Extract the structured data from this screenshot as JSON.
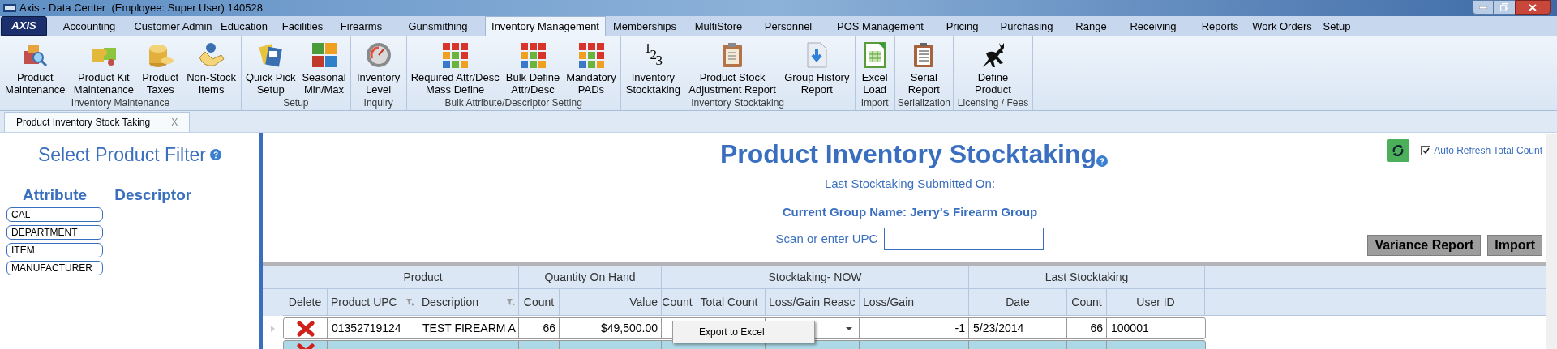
{
  "window": {
    "title": "Axis - Data Center  (Employee: Super User) 140528"
  },
  "logo": "AXIS",
  "menu_tabs": [
    {
      "label": "Accounting",
      "selected": false
    },
    {
      "label": "Customer Admin",
      "selected": false
    },
    {
      "label": "Education",
      "selected": false
    },
    {
      "label": "Facilities",
      "selected": false
    },
    {
      "label": "Firearms",
      "selected": false
    },
    {
      "label": "Gunsmithing",
      "selected": false
    },
    {
      "label": "Inventory Management",
      "selected": true
    },
    {
      "label": "Memberships",
      "selected": false
    },
    {
      "label": "MultiStore",
      "selected": false
    },
    {
      "label": "Personnel",
      "selected": false
    },
    {
      "label": "POS Management",
      "selected": false
    },
    {
      "label": "Pricing",
      "selected": false
    },
    {
      "label": "Purchasing",
      "selected": false
    },
    {
      "label": "Range",
      "selected": false
    },
    {
      "label": "Receiving",
      "selected": false
    },
    {
      "label": "Reports",
      "selected": false
    },
    {
      "label": "Work Orders",
      "selected": false
    },
    {
      "label": "Setup",
      "selected": false
    }
  ],
  "ribbon_groups": [
    {
      "label": "Inventory Maintenance",
      "buttons": [
        {
          "label": "Product\nMaintenance"
        },
        {
          "label": "Product Kit\nMaintenance"
        },
        {
          "label": "Product\nTaxes"
        },
        {
          "label": "Non-Stock\nItems"
        }
      ]
    },
    {
      "label": "Setup",
      "buttons": [
        {
          "label": "Quick Pick\nSetup"
        },
        {
          "label": "Seasonal\nMin/Max"
        }
      ]
    },
    {
      "label": "Inquiry",
      "buttons": [
        {
          "label": "Inventory\nLevel"
        }
      ]
    },
    {
      "label": "Bulk Attribute/Descriptor Setting",
      "buttons": [
        {
          "label": "Required Attr/Desc\nMass Define"
        },
        {
          "label": "Bulk Define\nAttr/Desc"
        },
        {
          "label": "Mandatory\nPADs"
        }
      ]
    },
    {
      "label": "Inventory Stocktaking",
      "buttons": [
        {
          "label": "Inventory\nStocktaking",
          "glyph": "123"
        },
        {
          "label": "Product Stock\nAdjustment Report"
        },
        {
          "label": "Group History\nReport"
        }
      ]
    },
    {
      "label": "Import",
      "buttons": [
        {
          "label": "Excel\nLoad"
        }
      ]
    },
    {
      "label": "Serialization",
      "buttons": [
        {
          "label": "Serial\nReport"
        }
      ]
    },
    {
      "label": "Licensing / Fees",
      "buttons": [
        {
          "label": "Define\nProduct"
        }
      ]
    }
  ],
  "doc_tabs": [
    {
      "label": "Product Inventory Stock Taking",
      "close": "X",
      "selected": true
    }
  ],
  "filter": {
    "title": "Select Product Filter",
    "attribute_heading": "Attribute",
    "descriptor_heading": "Descriptor",
    "attributes": [
      "CAL",
      "DEPARTMENT",
      "ITEM",
      "MANUFACTURER"
    ]
  },
  "main": {
    "title": "Product Inventory Stocktaking",
    "last_submitted": "Last Stocktaking Submitted On:",
    "group_name": "Current Group Name: Jerry's Firearm Group",
    "upc_label": "Scan or enter UPC",
    "auto_refresh": {
      "label": "Auto Refresh Total Count",
      "checked": true
    },
    "buttons": [
      "Variance Report",
      "Import"
    ]
  },
  "table": {
    "column_groups": [
      "Product",
      "Quantity On Hand",
      "Stocktaking- NOW",
      "Last Stocktaking"
    ],
    "columns": [
      "Delete",
      "Product UPC",
      "Description",
      "Count",
      "Value",
      "Count",
      "Total Count",
      "Loss/Gain Reasc",
      "Loss/Gain",
      "Date",
      "Count",
      "User ID"
    ],
    "rows": [
      {
        "selected": false,
        "cells": [
          "",
          "01352719124",
          "TEST FIREARM A",
          "66",
          "$49,500.00",
          "",
          "",
          "",
          "-1",
          "5/23/2014",
          "66",
          "100001"
        ]
      },
      {
        "selected": true,
        "cells": [
          ""
        ]
      }
    ]
  },
  "context_menu": {
    "items": [
      "Export to Excel"
    ]
  }
}
